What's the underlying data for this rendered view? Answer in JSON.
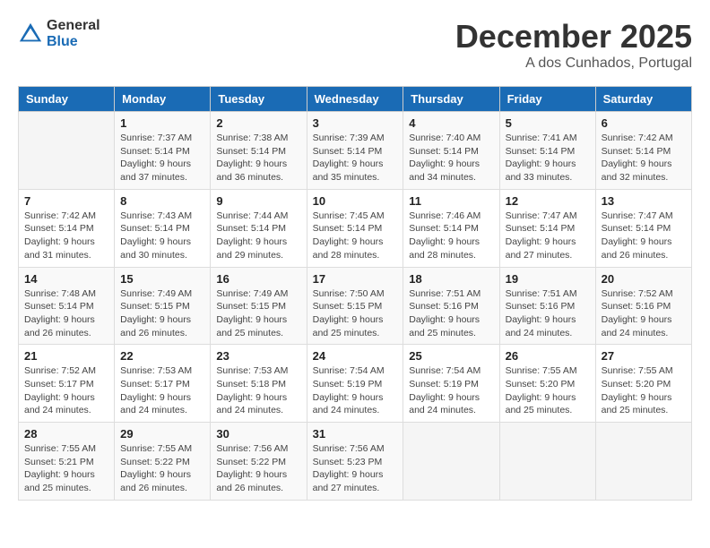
{
  "header": {
    "logo_general": "General",
    "logo_blue": "Blue",
    "title": "December 2025",
    "location": "A dos Cunhados, Portugal"
  },
  "weekdays": [
    "Sunday",
    "Monday",
    "Tuesday",
    "Wednesday",
    "Thursday",
    "Friday",
    "Saturday"
  ],
  "weeks": [
    [
      {
        "day": "",
        "sunrise": "",
        "sunset": "",
        "daylight": ""
      },
      {
        "day": "1",
        "sunrise": "Sunrise: 7:37 AM",
        "sunset": "Sunset: 5:14 PM",
        "daylight": "Daylight: 9 hours and 37 minutes."
      },
      {
        "day": "2",
        "sunrise": "Sunrise: 7:38 AM",
        "sunset": "Sunset: 5:14 PM",
        "daylight": "Daylight: 9 hours and 36 minutes."
      },
      {
        "day": "3",
        "sunrise": "Sunrise: 7:39 AM",
        "sunset": "Sunset: 5:14 PM",
        "daylight": "Daylight: 9 hours and 35 minutes."
      },
      {
        "day": "4",
        "sunrise": "Sunrise: 7:40 AM",
        "sunset": "Sunset: 5:14 PM",
        "daylight": "Daylight: 9 hours and 34 minutes."
      },
      {
        "day": "5",
        "sunrise": "Sunrise: 7:41 AM",
        "sunset": "Sunset: 5:14 PM",
        "daylight": "Daylight: 9 hours and 33 minutes."
      },
      {
        "day": "6",
        "sunrise": "Sunrise: 7:42 AM",
        "sunset": "Sunset: 5:14 PM",
        "daylight": "Daylight: 9 hours and 32 minutes."
      }
    ],
    [
      {
        "day": "7",
        "sunrise": "Sunrise: 7:42 AM",
        "sunset": "Sunset: 5:14 PM",
        "daylight": "Daylight: 9 hours and 31 minutes."
      },
      {
        "day": "8",
        "sunrise": "Sunrise: 7:43 AM",
        "sunset": "Sunset: 5:14 PM",
        "daylight": "Daylight: 9 hours and 30 minutes."
      },
      {
        "day": "9",
        "sunrise": "Sunrise: 7:44 AM",
        "sunset": "Sunset: 5:14 PM",
        "daylight": "Daylight: 9 hours and 29 minutes."
      },
      {
        "day": "10",
        "sunrise": "Sunrise: 7:45 AM",
        "sunset": "Sunset: 5:14 PM",
        "daylight": "Daylight: 9 hours and 28 minutes."
      },
      {
        "day": "11",
        "sunrise": "Sunrise: 7:46 AM",
        "sunset": "Sunset: 5:14 PM",
        "daylight": "Daylight: 9 hours and 28 minutes."
      },
      {
        "day": "12",
        "sunrise": "Sunrise: 7:47 AM",
        "sunset": "Sunset: 5:14 PM",
        "daylight": "Daylight: 9 hours and 27 minutes."
      },
      {
        "day": "13",
        "sunrise": "Sunrise: 7:47 AM",
        "sunset": "Sunset: 5:14 PM",
        "daylight": "Daylight: 9 hours and 26 minutes."
      }
    ],
    [
      {
        "day": "14",
        "sunrise": "Sunrise: 7:48 AM",
        "sunset": "Sunset: 5:14 PM",
        "daylight": "Daylight: 9 hours and 26 minutes."
      },
      {
        "day": "15",
        "sunrise": "Sunrise: 7:49 AM",
        "sunset": "Sunset: 5:15 PM",
        "daylight": "Daylight: 9 hours and 26 minutes."
      },
      {
        "day": "16",
        "sunrise": "Sunrise: 7:49 AM",
        "sunset": "Sunset: 5:15 PM",
        "daylight": "Daylight: 9 hours and 25 minutes."
      },
      {
        "day": "17",
        "sunrise": "Sunrise: 7:50 AM",
        "sunset": "Sunset: 5:15 PM",
        "daylight": "Daylight: 9 hours and 25 minutes."
      },
      {
        "day": "18",
        "sunrise": "Sunrise: 7:51 AM",
        "sunset": "Sunset: 5:16 PM",
        "daylight": "Daylight: 9 hours and 25 minutes."
      },
      {
        "day": "19",
        "sunrise": "Sunrise: 7:51 AM",
        "sunset": "Sunset: 5:16 PM",
        "daylight": "Daylight: 9 hours and 24 minutes."
      },
      {
        "day": "20",
        "sunrise": "Sunrise: 7:52 AM",
        "sunset": "Sunset: 5:16 PM",
        "daylight": "Daylight: 9 hours and 24 minutes."
      }
    ],
    [
      {
        "day": "21",
        "sunrise": "Sunrise: 7:52 AM",
        "sunset": "Sunset: 5:17 PM",
        "daylight": "Daylight: 9 hours and 24 minutes."
      },
      {
        "day": "22",
        "sunrise": "Sunrise: 7:53 AM",
        "sunset": "Sunset: 5:17 PM",
        "daylight": "Daylight: 9 hours and 24 minutes."
      },
      {
        "day": "23",
        "sunrise": "Sunrise: 7:53 AM",
        "sunset": "Sunset: 5:18 PM",
        "daylight": "Daylight: 9 hours and 24 minutes."
      },
      {
        "day": "24",
        "sunrise": "Sunrise: 7:54 AM",
        "sunset": "Sunset: 5:19 PM",
        "daylight": "Daylight: 9 hours and 24 minutes."
      },
      {
        "day": "25",
        "sunrise": "Sunrise: 7:54 AM",
        "sunset": "Sunset: 5:19 PM",
        "daylight": "Daylight: 9 hours and 24 minutes."
      },
      {
        "day": "26",
        "sunrise": "Sunrise: 7:55 AM",
        "sunset": "Sunset: 5:20 PM",
        "daylight": "Daylight: 9 hours and 25 minutes."
      },
      {
        "day": "27",
        "sunrise": "Sunrise: 7:55 AM",
        "sunset": "Sunset: 5:20 PM",
        "daylight": "Daylight: 9 hours and 25 minutes."
      }
    ],
    [
      {
        "day": "28",
        "sunrise": "Sunrise: 7:55 AM",
        "sunset": "Sunset: 5:21 PM",
        "daylight": "Daylight: 9 hours and 25 minutes."
      },
      {
        "day": "29",
        "sunrise": "Sunrise: 7:55 AM",
        "sunset": "Sunset: 5:22 PM",
        "daylight": "Daylight: 9 hours and 26 minutes."
      },
      {
        "day": "30",
        "sunrise": "Sunrise: 7:56 AM",
        "sunset": "Sunset: 5:22 PM",
        "daylight": "Daylight: 9 hours and 26 minutes."
      },
      {
        "day": "31",
        "sunrise": "Sunrise: 7:56 AM",
        "sunset": "Sunset: 5:23 PM",
        "daylight": "Daylight: 9 hours and 27 minutes."
      },
      {
        "day": "",
        "sunrise": "",
        "sunset": "",
        "daylight": ""
      },
      {
        "day": "",
        "sunrise": "",
        "sunset": "",
        "daylight": ""
      },
      {
        "day": "",
        "sunrise": "",
        "sunset": "",
        "daylight": ""
      }
    ]
  ]
}
